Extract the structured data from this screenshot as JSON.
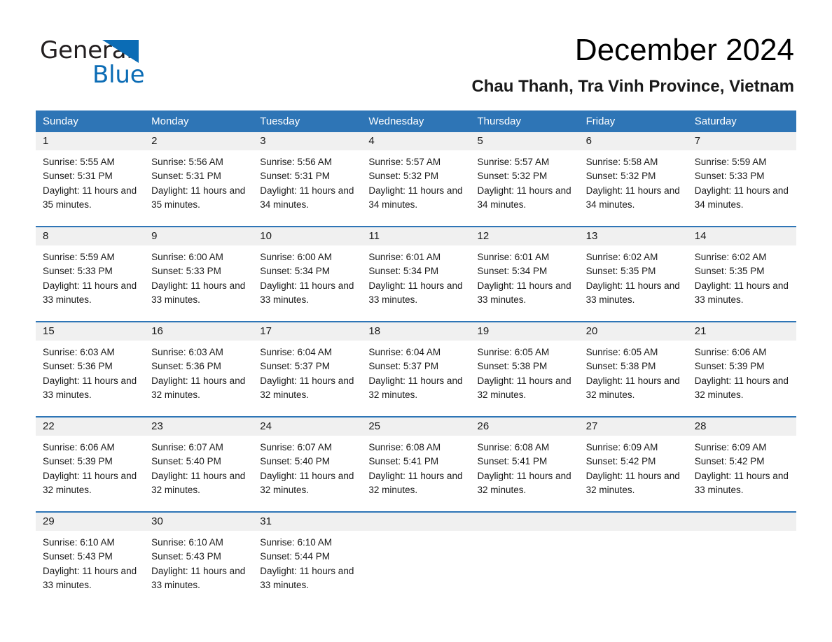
{
  "brand": {
    "name_part1": "General",
    "name_part2": "Blue",
    "triangle_icon": "triangle-logo-icon",
    "accent_color": "#0b6cb5"
  },
  "header": {
    "month_title": "December 2024",
    "location": "Chau Thanh, Tra Vinh Province, Vietnam"
  },
  "calendar": {
    "header_bg": "#2e75b6",
    "date_band_bg": "#f0f0f0",
    "weekdays": [
      "Sunday",
      "Monday",
      "Tuesday",
      "Wednesday",
      "Thursday",
      "Friday",
      "Saturday"
    ],
    "weeks": [
      {
        "days": [
          {
            "date": "1",
            "sunrise": "Sunrise: 5:55 AM",
            "sunset": "Sunset: 5:31 PM",
            "daylight": "Daylight: 11 hours and 35 minutes."
          },
          {
            "date": "2",
            "sunrise": "Sunrise: 5:56 AM",
            "sunset": "Sunset: 5:31 PM",
            "daylight": "Daylight: 11 hours and 35 minutes."
          },
          {
            "date": "3",
            "sunrise": "Sunrise: 5:56 AM",
            "sunset": "Sunset: 5:31 PM",
            "daylight": "Daylight: 11 hours and 34 minutes."
          },
          {
            "date": "4",
            "sunrise": "Sunrise: 5:57 AM",
            "sunset": "Sunset: 5:32 PM",
            "daylight": "Daylight: 11 hours and 34 minutes."
          },
          {
            "date": "5",
            "sunrise": "Sunrise: 5:57 AM",
            "sunset": "Sunset: 5:32 PM",
            "daylight": "Daylight: 11 hours and 34 minutes."
          },
          {
            "date": "6",
            "sunrise": "Sunrise: 5:58 AM",
            "sunset": "Sunset: 5:32 PM",
            "daylight": "Daylight: 11 hours and 34 minutes."
          },
          {
            "date": "7",
            "sunrise": "Sunrise: 5:59 AM",
            "sunset": "Sunset: 5:33 PM",
            "daylight": "Daylight: 11 hours and 34 minutes."
          }
        ]
      },
      {
        "days": [
          {
            "date": "8",
            "sunrise": "Sunrise: 5:59 AM",
            "sunset": "Sunset: 5:33 PM",
            "daylight": "Daylight: 11 hours and 33 minutes."
          },
          {
            "date": "9",
            "sunrise": "Sunrise: 6:00 AM",
            "sunset": "Sunset: 5:33 PM",
            "daylight": "Daylight: 11 hours and 33 minutes."
          },
          {
            "date": "10",
            "sunrise": "Sunrise: 6:00 AM",
            "sunset": "Sunset: 5:34 PM",
            "daylight": "Daylight: 11 hours and 33 minutes."
          },
          {
            "date": "11",
            "sunrise": "Sunrise: 6:01 AM",
            "sunset": "Sunset: 5:34 PM",
            "daylight": "Daylight: 11 hours and 33 minutes."
          },
          {
            "date": "12",
            "sunrise": "Sunrise: 6:01 AM",
            "sunset": "Sunset: 5:34 PM",
            "daylight": "Daylight: 11 hours and 33 minutes."
          },
          {
            "date": "13",
            "sunrise": "Sunrise: 6:02 AM",
            "sunset": "Sunset: 5:35 PM",
            "daylight": "Daylight: 11 hours and 33 minutes."
          },
          {
            "date": "14",
            "sunrise": "Sunrise: 6:02 AM",
            "sunset": "Sunset: 5:35 PM",
            "daylight": "Daylight: 11 hours and 33 minutes."
          }
        ]
      },
      {
        "days": [
          {
            "date": "15",
            "sunrise": "Sunrise: 6:03 AM",
            "sunset": "Sunset: 5:36 PM",
            "daylight": "Daylight: 11 hours and 33 minutes."
          },
          {
            "date": "16",
            "sunrise": "Sunrise: 6:03 AM",
            "sunset": "Sunset: 5:36 PM",
            "daylight": "Daylight: 11 hours and 32 minutes."
          },
          {
            "date": "17",
            "sunrise": "Sunrise: 6:04 AM",
            "sunset": "Sunset: 5:37 PM",
            "daylight": "Daylight: 11 hours and 32 minutes."
          },
          {
            "date": "18",
            "sunrise": "Sunrise: 6:04 AM",
            "sunset": "Sunset: 5:37 PM",
            "daylight": "Daylight: 11 hours and 32 minutes."
          },
          {
            "date": "19",
            "sunrise": "Sunrise: 6:05 AM",
            "sunset": "Sunset: 5:38 PM",
            "daylight": "Daylight: 11 hours and 32 minutes."
          },
          {
            "date": "20",
            "sunrise": "Sunrise: 6:05 AM",
            "sunset": "Sunset: 5:38 PM",
            "daylight": "Daylight: 11 hours and 32 minutes."
          },
          {
            "date": "21",
            "sunrise": "Sunrise: 6:06 AM",
            "sunset": "Sunset: 5:39 PM",
            "daylight": "Daylight: 11 hours and 32 minutes."
          }
        ]
      },
      {
        "days": [
          {
            "date": "22",
            "sunrise": "Sunrise: 6:06 AM",
            "sunset": "Sunset: 5:39 PM",
            "daylight": "Daylight: 11 hours and 32 minutes."
          },
          {
            "date": "23",
            "sunrise": "Sunrise: 6:07 AM",
            "sunset": "Sunset: 5:40 PM",
            "daylight": "Daylight: 11 hours and 32 minutes."
          },
          {
            "date": "24",
            "sunrise": "Sunrise: 6:07 AM",
            "sunset": "Sunset: 5:40 PM",
            "daylight": "Daylight: 11 hours and 32 minutes."
          },
          {
            "date": "25",
            "sunrise": "Sunrise: 6:08 AM",
            "sunset": "Sunset: 5:41 PM",
            "daylight": "Daylight: 11 hours and 32 minutes."
          },
          {
            "date": "26",
            "sunrise": "Sunrise: 6:08 AM",
            "sunset": "Sunset: 5:41 PM",
            "daylight": "Daylight: 11 hours and 32 minutes."
          },
          {
            "date": "27",
            "sunrise": "Sunrise: 6:09 AM",
            "sunset": "Sunset: 5:42 PM",
            "daylight": "Daylight: 11 hours and 32 minutes."
          },
          {
            "date": "28",
            "sunrise": "Sunrise: 6:09 AM",
            "sunset": "Sunset: 5:42 PM",
            "daylight": "Daylight: 11 hours and 33 minutes."
          }
        ]
      },
      {
        "days": [
          {
            "date": "29",
            "sunrise": "Sunrise: 6:10 AM",
            "sunset": "Sunset: 5:43 PM",
            "daylight": "Daylight: 11 hours and 33 minutes."
          },
          {
            "date": "30",
            "sunrise": "Sunrise: 6:10 AM",
            "sunset": "Sunset: 5:43 PM",
            "daylight": "Daylight: 11 hours and 33 minutes."
          },
          {
            "date": "31",
            "sunrise": "Sunrise: 6:10 AM",
            "sunset": "Sunset: 5:44 PM",
            "daylight": "Daylight: 11 hours and 33 minutes."
          },
          {
            "date": "",
            "sunrise": "",
            "sunset": "",
            "daylight": ""
          },
          {
            "date": "",
            "sunrise": "",
            "sunset": "",
            "daylight": ""
          },
          {
            "date": "",
            "sunrise": "",
            "sunset": "",
            "daylight": ""
          },
          {
            "date": "",
            "sunrise": "",
            "sunset": "",
            "daylight": ""
          }
        ]
      }
    ]
  }
}
